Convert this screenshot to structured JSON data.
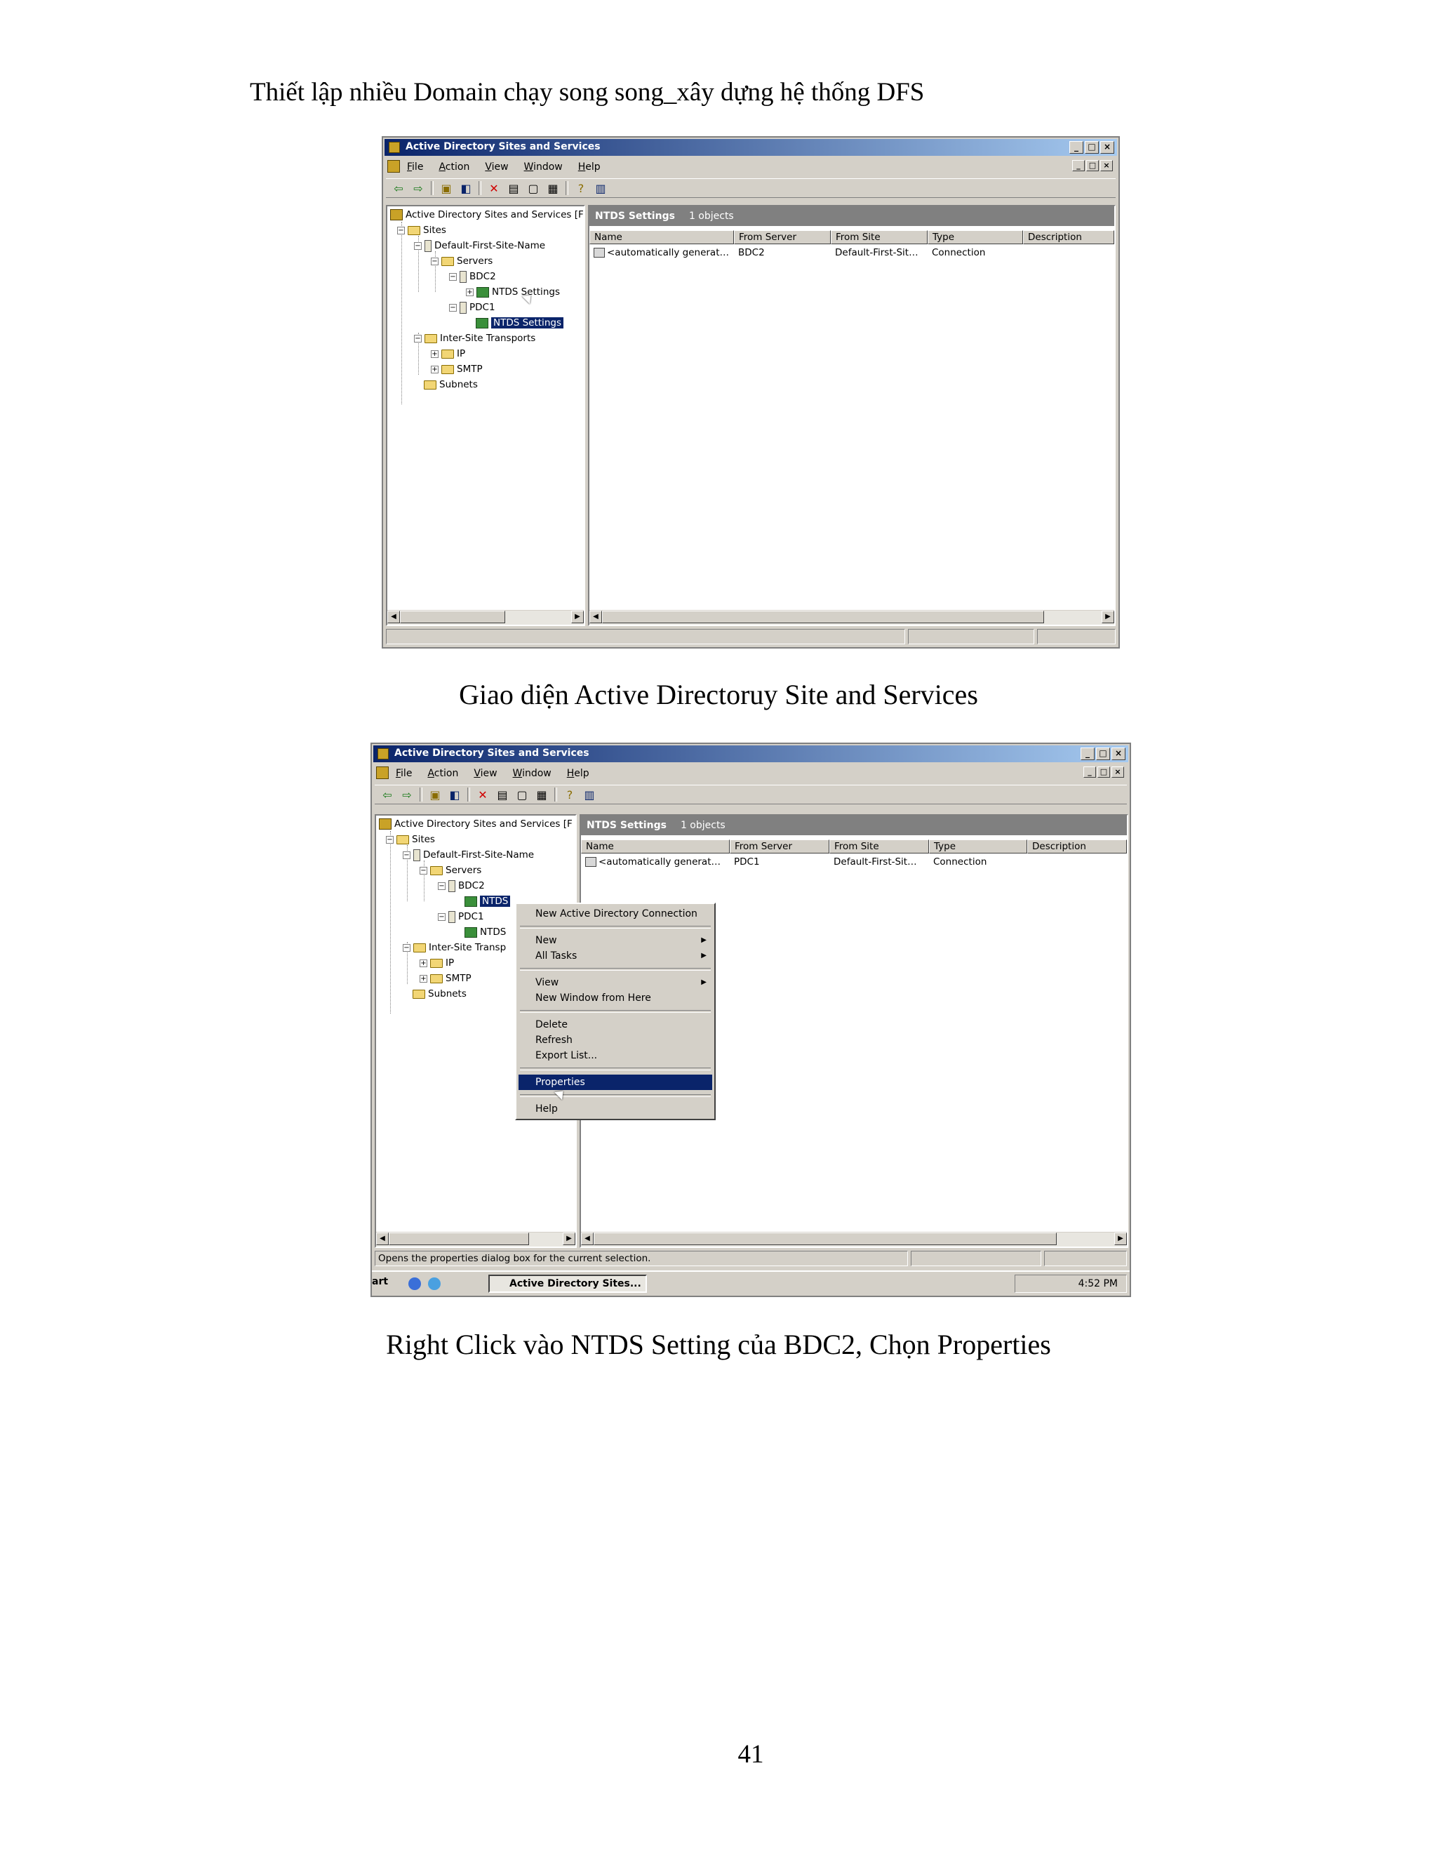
{
  "document": {
    "title": "Thiết lập nhiều Domain chạy song song_xây dựng hệ thống DFS",
    "caption1": "Giao diện Active Directoruy Site and Services",
    "caption2": "Right Click vào NTDS Setting của BDC2, Chọn Properties",
    "page_number": "41"
  },
  "window": {
    "title": "Active Directory Sites and Services",
    "menu": [
      "File",
      "Action",
      "View",
      "Window",
      "Help"
    ],
    "caption_buttons": [
      "_",
      "□",
      "×"
    ],
    "toolbar_icons": [
      "back-icon",
      "forward-icon",
      "up-folder-icon",
      "show-tree-icon",
      "delete-icon",
      "properties-icon",
      "export-icon",
      "refresh-icon",
      "help-icon",
      "console-icon"
    ]
  },
  "tree": {
    "root": "Active Directory Sites and Services [F",
    "sites": "Sites",
    "site_name": "Default-First-Site-Name",
    "servers": "Servers",
    "bdc2": "BDC2",
    "ntds1": "NTDS Settings",
    "pdc1": "PDC1",
    "ntds2": "NTDS Settings",
    "inter_site": "Inter-Site Transports",
    "ip": "IP",
    "smtp": "SMTP",
    "subnets": "Subnets"
  },
  "tree2": {
    "root": "Active Directory Sites and Services [F",
    "sites": "Sites",
    "site_name": "Default-First-Site-Name",
    "servers": "Servers",
    "bdc2": "BDC2",
    "ntds1": "NTDS",
    "pdc1": "PDC1",
    "ntds2": "NTDS",
    "inter_site": "Inter-Site Transp",
    "ip": "IP",
    "smtp": "SMTP",
    "subnets": "Subnets"
  },
  "list_header": {
    "title": "NTDS Settings",
    "count": "1 objects"
  },
  "columns": [
    "Name",
    "From Server",
    "From Site",
    "Type",
    "Description"
  ],
  "screenshot1_row": {
    "name": "<automatically generat…",
    "from_server": "BDC2",
    "from_site": "Default-First-Sit…",
    "type": "Connection",
    "description": ""
  },
  "screenshot2_row": {
    "name": "<automatically generat…",
    "from_server": "PDC1",
    "from_site": "Default-First-Sit…",
    "type": "Connection",
    "description": ""
  },
  "context_menu": {
    "new_connection": "New Active Directory Connection",
    "new": "New",
    "all_tasks": "All Tasks",
    "view": "View",
    "new_window": "New Window from Here",
    "delete": "Delete",
    "refresh": "Refresh",
    "export_list": "Export List...",
    "properties": "Properties",
    "help": "Help"
  },
  "status_text": "Opens the properties dialog box for the current selection.",
  "taskbar": {
    "start": "art",
    "task": "Active Directory Sites...",
    "clock": "4:52 PM"
  },
  "colors": {
    "titlebar": "#0a246a",
    "face": "#d4d0c8",
    "selection": "#0a246a"
  }
}
